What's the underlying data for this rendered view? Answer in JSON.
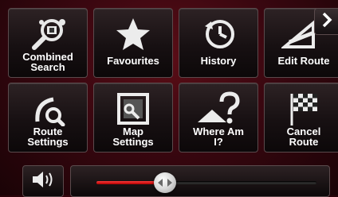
{
  "menu": {
    "tiles": [
      {
        "label": "Combined\nSearch",
        "icon": "combined-search-icon"
      },
      {
        "label": "Favourites",
        "icon": "star-icon"
      },
      {
        "label": "History",
        "icon": "history-icon"
      },
      {
        "label": "Edit Route",
        "icon": "edit-route-icon"
      },
      {
        "label": "Route\nSettings",
        "icon": "route-settings-icon"
      },
      {
        "label": "Map\nSettings",
        "icon": "map-settings-icon"
      },
      {
        "label": "Where Am\nI?",
        "icon": "where-am-i-icon"
      },
      {
        "label": "Cancel\nRoute",
        "icon": "checkered-flag-icon"
      }
    ]
  },
  "navigation": {
    "next_icon": "chevron-right-icon"
  },
  "volume": {
    "icon": "speaker-icon",
    "level": 0.31
  }
}
